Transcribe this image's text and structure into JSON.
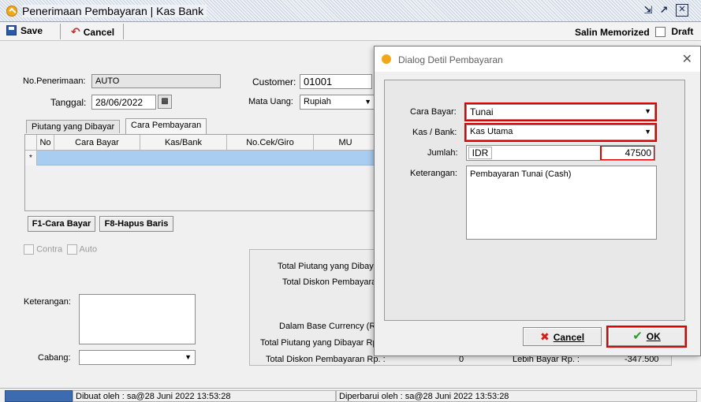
{
  "window": {
    "title": "Penerimaan Pembayaran | Kas Bank",
    "controls": [
      "restore-down-icon",
      "maximize-icon",
      "close-icon"
    ]
  },
  "toolbar": {
    "save_label": "Save",
    "cancel_label": "Cancel",
    "salin_label": "Salin Memorized",
    "draft_label": "Draft"
  },
  "form": {
    "no_penerimaan_label": "No.Penerimaan:",
    "no_penerimaan_value": "AUTO",
    "tanggal_label": "Tanggal:",
    "tanggal_value": "28/06/2022",
    "customer_label": "Customer:",
    "customer_value": "01001",
    "mata_uang_label": "Mata Uang:",
    "mata_uang_value": "Rupiah"
  },
  "tabs": [
    {
      "label": "Piutang yang Dibayar"
    },
    {
      "label": "Cara Pembayaran"
    }
  ],
  "grid": {
    "columns": [
      "No",
      "Cara Bayar",
      "Kas/Bank",
      "No.Cek/Giro",
      "MU"
    ],
    "new_row_marker": "*"
  },
  "buttons": {
    "f1": "F1-Cara Bayar",
    "f8": "F8-Hapus Baris"
  },
  "options": {
    "contra_label": "Contra",
    "auto_label": "Auto"
  },
  "bottom": {
    "keterangan_label": "Keterangan:",
    "cabang_label": "Cabang:"
  },
  "totals": {
    "total_piutang_label": "Total Piutang yang Dibaya",
    "total_diskon_label": "Total Diskon Pembayara",
    "base_currency_label": "Dalam Base Currency (Rp",
    "total_piutang_rp_label": "Total Piutang yang Dibayar Rp",
    "total_diskon_rp_label": "Total Diskon Pembayaran Rp. :",
    "total_diskon_rp_value": "0",
    "lebih_bayar_label": "Lebih Bayar Rp. :",
    "lebih_bayar_value": "-347.500"
  },
  "status": {
    "dibuat": "Dibuat oleh : sa@28 Juni 2022  13:53:28",
    "diperbarui": "Diperbarui oleh : sa@28 Juni 2022  13:53:28"
  },
  "dialog": {
    "title": "Dialog Detil Pembayaran",
    "cara_bayar_label": "Cara Bayar:",
    "cara_bayar_value": "Tunai",
    "kas_bank_label": "Kas / Bank:",
    "kas_bank_value": "Kas Utama",
    "jumlah_label": "Jumlah:",
    "jumlah_currency": "IDR",
    "jumlah_value": "47500",
    "keterangan_label": "Keterangan:",
    "keterangan_value": "Pembayaran Tunai (Cash)",
    "cancel_label": "Cancel",
    "ok_label": "OK"
  },
  "colors": {
    "highlight": "#e00000",
    "grid_row": "#a9cdf1",
    "status_blue": "#3c6bb0",
    "ok_check": "#2e9b2e",
    "cancel_x": "#d02020"
  }
}
